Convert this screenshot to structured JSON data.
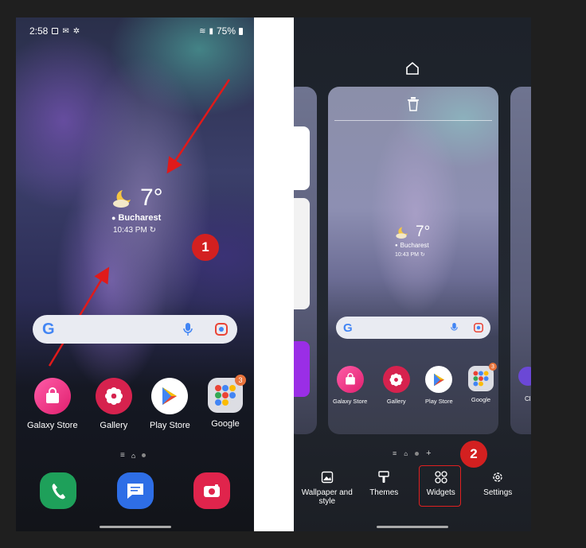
{
  "left_phone": {
    "status": {
      "time": "2:58",
      "battery": "75%"
    },
    "weather": {
      "temp": "7°",
      "city": "Bucharest",
      "time": "10:43 PM"
    },
    "apps": [
      {
        "label": "Galaxy Store"
      },
      {
        "label": "Gallery"
      },
      {
        "label": "Play Store"
      },
      {
        "label": "Google",
        "badge": "3"
      }
    ],
    "marker": "1"
  },
  "right_phone": {
    "weather": {
      "temp": "7°",
      "city": "Bucharest",
      "time": "10:43 PM"
    },
    "apps": [
      {
        "label": "Galaxy Store"
      },
      {
        "label": "Gallery"
      },
      {
        "label": "Play Store"
      },
      {
        "label": "Google",
        "badge": "3"
      }
    ],
    "side_label": "Cl",
    "menu": [
      {
        "label": "Wallpaper and style",
        "icon": "wallpaper-icon"
      },
      {
        "label": "Themes",
        "icon": "brush-icon"
      },
      {
        "label": "Widgets",
        "icon": "widgets-icon"
      },
      {
        "label": "Settings",
        "icon": "gear-icon"
      }
    ],
    "marker": "2"
  },
  "colors": {
    "marker_red": "#d32020",
    "badge_orange": "#e8733b"
  }
}
